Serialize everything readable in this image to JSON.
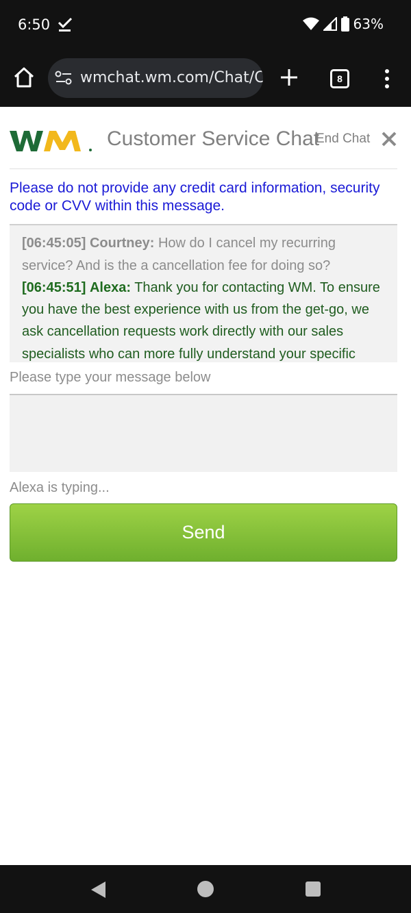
{
  "status_bar": {
    "time": "6:50",
    "battery": "63%",
    "icons": [
      "check-icon",
      "wifi-icon",
      "signal-icon",
      "battery-icon"
    ]
  },
  "browser": {
    "url": "wmchat.wm.com/Chat/C",
    "tab_count": "8",
    "icons": [
      "home-icon",
      "site-settings-icon",
      "new-tab-icon",
      "tabs-icon",
      "menu-icon"
    ]
  },
  "header": {
    "logo_text": "WM",
    "title": "Customer Service Chat",
    "end_chat": "End Chat"
  },
  "warning": "Please do not provide any credit card information, security code or CVV within this message.",
  "transcript": {
    "messages": [
      {
        "time": "[06:45:05]",
        "sender": "Courtney:",
        "text": "How do I cancel my recurring service? And is the a cancellation fee for doing so?"
      },
      {
        "time": "[06:45:51]",
        "sender": "Alexa:",
        "text": "Thank you for contacting WM. To ensure you have the best experience with us from the get-go, we ask cancellation requests work directly with our sales specialists who can more fully understand your specific"
      }
    ]
  },
  "composer": {
    "prompt": "Please type your message below",
    "value": "",
    "typing_indicator": "Alexa is typing...",
    "send_label": "Send"
  },
  "colors": {
    "wm_green": "#1e6b37",
    "wm_yellow": "#f2b81c",
    "warning_blue": "#1a1ad6",
    "send_green": "#8cc63f",
    "agent_green": "#1f5c1f"
  },
  "nav_bar": {
    "icons": [
      "back-icon",
      "home-circle-icon",
      "recents-icon"
    ]
  }
}
